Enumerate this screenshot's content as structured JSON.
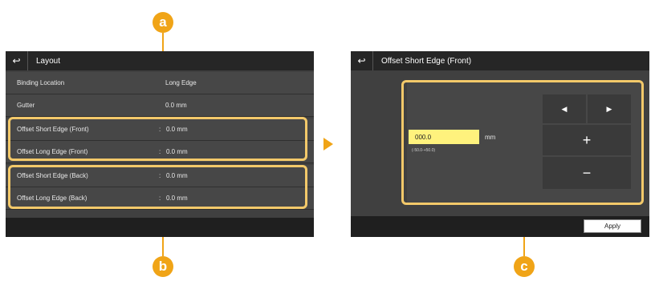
{
  "left_screen": {
    "title": "Layout",
    "back_icon": "back-arrow-icon",
    "rows": [
      {
        "label": "Binding Location",
        "value": "Long Edge"
      },
      {
        "label": "Gutter",
        "value": "0.0 mm"
      },
      {
        "label": "Offset Short Edge (Front)",
        "value": "0.0 mm"
      },
      {
        "label": "Offset Long Edge (Front)",
        "value": "0.0 mm"
      },
      {
        "label": "Offset Short Edge (Back)",
        "value": "0.0 mm"
      },
      {
        "label": "Offset Long Edge (Back)",
        "value": "0.0 mm"
      }
    ],
    "colon": ":"
  },
  "right_screen": {
    "title": "Offset Short Edge (Front)",
    "back_icon": "back-arrow-icon",
    "value": "000.0",
    "unit": "mm",
    "range": "(-50.0-+50.0)",
    "keys": {
      "left": "◀",
      "right": "▶",
      "plus": "+",
      "minus": "−"
    },
    "apply_label": "Apply"
  },
  "callouts": {
    "a": "a",
    "b": "b",
    "c": "c"
  },
  "colors": {
    "accent": "#f0a417",
    "highlight": "#f3c96a",
    "value_field": "#fff27d"
  }
}
